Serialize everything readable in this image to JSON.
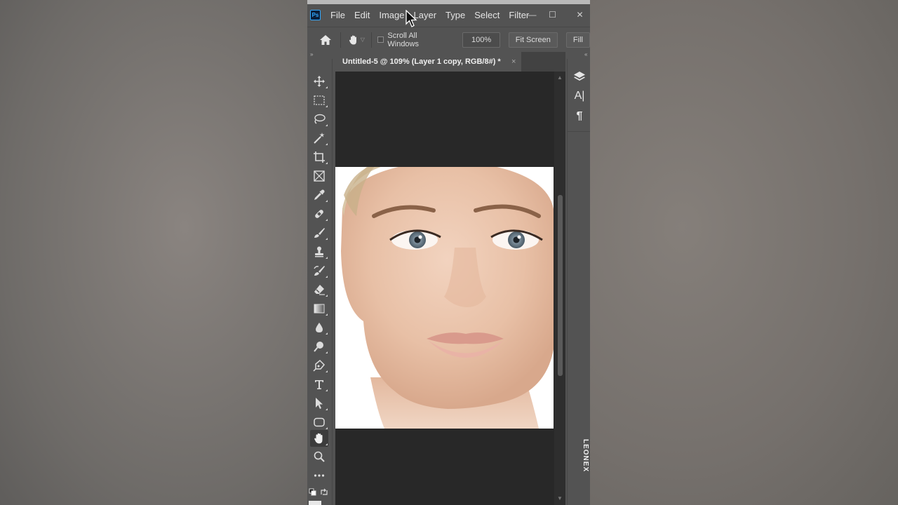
{
  "app": {
    "logo_text": "Ps",
    "menu": [
      "File",
      "Edit",
      "Image",
      "Layer",
      "Type",
      "Select",
      "Filter"
    ]
  },
  "window_controls": {
    "minimize": "—",
    "maximize": "☐",
    "close": "✕"
  },
  "options_bar": {
    "scroll_all_windows_label": "Scroll All Windows",
    "scroll_all_windows_checked": false,
    "zoom_value": "100%",
    "fit_screen_label": "Fit Screen",
    "fill_label": "Fill"
  },
  "document_tab": {
    "title": "Untitled-5 @ 109% (Layer 1 copy, RGB/8#) *",
    "close": "×"
  },
  "toolbar": {
    "active_tool": "hand-tool",
    "tools": [
      "move",
      "marquee",
      "lasso",
      "magic-wand",
      "crop",
      "frame",
      "eyedropper",
      "healing",
      "brush",
      "stamp",
      "history-brush",
      "eraser",
      "gradient",
      "blur",
      "dodge",
      "pen",
      "type",
      "path-select",
      "shape",
      "hand",
      "zoom",
      "more"
    ]
  },
  "right_panel": {
    "icons": [
      "layers-icon",
      "character-icon",
      "paragraph-icon"
    ],
    "char_text": "A|",
    "para_text": "¶"
  },
  "watermark": "LEONEX",
  "colors": {
    "ui_bg": "#535353",
    "canvas_bg": "#282828",
    "accent": "#31a8ff"
  }
}
